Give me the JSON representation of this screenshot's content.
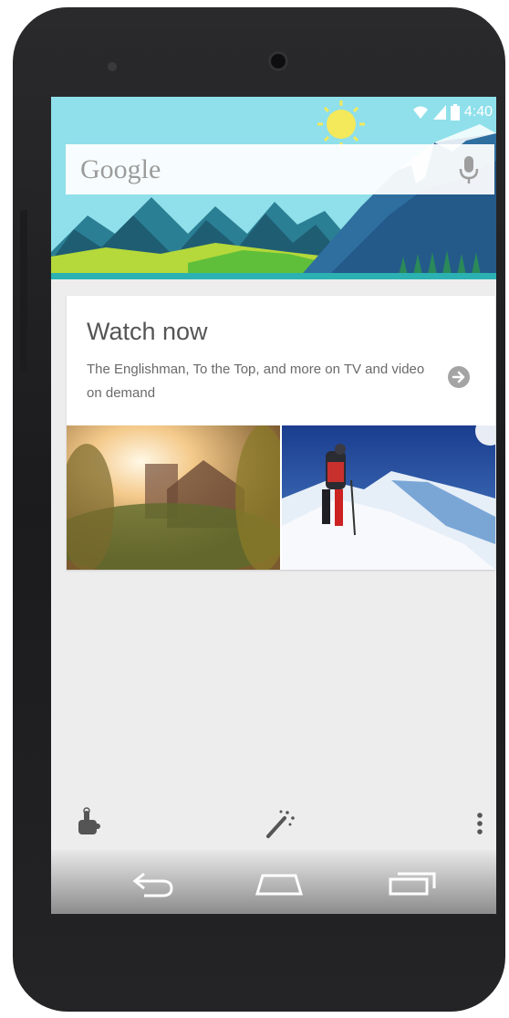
{
  "status_bar": {
    "time": "4:40",
    "icons": [
      "wifi-icon",
      "signal-icon",
      "battery-icon"
    ]
  },
  "search": {
    "logo_text": "Google",
    "mic_icon": "microphone-icon"
  },
  "card": {
    "title": "Watch now",
    "description": "The Englishman, To the Top, and more on TV and video on demand",
    "arrow_icon": "arrow-right-circle-icon",
    "thumbnails": [
      "castle-sunlight-thumbnail",
      "mountain-climber-thumbnail"
    ]
  },
  "bottom_actions": [
    "hand-pointer-icon",
    "magic-wand-icon",
    "overflow-menu-icon"
  ],
  "navigation": [
    "back-icon",
    "home-icon",
    "recents-icon"
  ],
  "colors": {
    "sky": "#8fe0ea",
    "mountain": "#1f5d73",
    "grass": "#b5d83a",
    "card": "#ffffff",
    "screen_bg": "#ededed"
  }
}
